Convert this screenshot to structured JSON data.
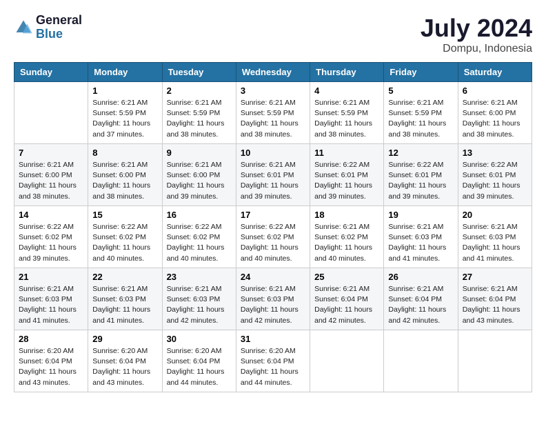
{
  "logo": {
    "line1": "General",
    "line2": "Blue"
  },
  "title": "July 2024",
  "location": "Dompu, Indonesia",
  "header": {
    "days": [
      "Sunday",
      "Monday",
      "Tuesday",
      "Wednesday",
      "Thursday",
      "Friday",
      "Saturday"
    ]
  },
  "weeks": [
    {
      "row": 1,
      "cells": [
        {
          "day": "",
          "info": ""
        },
        {
          "day": "1",
          "info": "Sunrise: 6:21 AM\nSunset: 5:59 PM\nDaylight: 11 hours\nand 37 minutes."
        },
        {
          "day": "2",
          "info": "Sunrise: 6:21 AM\nSunset: 5:59 PM\nDaylight: 11 hours\nand 38 minutes."
        },
        {
          "day": "3",
          "info": "Sunrise: 6:21 AM\nSunset: 5:59 PM\nDaylight: 11 hours\nand 38 minutes."
        },
        {
          "day": "4",
          "info": "Sunrise: 6:21 AM\nSunset: 5:59 PM\nDaylight: 11 hours\nand 38 minutes."
        },
        {
          "day": "5",
          "info": "Sunrise: 6:21 AM\nSunset: 5:59 PM\nDaylight: 11 hours\nand 38 minutes."
        },
        {
          "day": "6",
          "info": "Sunrise: 6:21 AM\nSunset: 6:00 PM\nDaylight: 11 hours\nand 38 minutes."
        }
      ]
    },
    {
      "row": 2,
      "cells": [
        {
          "day": "7",
          "info": "Sunrise: 6:21 AM\nSunset: 6:00 PM\nDaylight: 11 hours\nand 38 minutes."
        },
        {
          "day": "8",
          "info": "Sunrise: 6:21 AM\nSunset: 6:00 PM\nDaylight: 11 hours\nand 38 minutes."
        },
        {
          "day": "9",
          "info": "Sunrise: 6:21 AM\nSunset: 6:00 PM\nDaylight: 11 hours\nand 39 minutes."
        },
        {
          "day": "10",
          "info": "Sunrise: 6:21 AM\nSunset: 6:01 PM\nDaylight: 11 hours\nand 39 minutes."
        },
        {
          "day": "11",
          "info": "Sunrise: 6:22 AM\nSunset: 6:01 PM\nDaylight: 11 hours\nand 39 minutes."
        },
        {
          "day": "12",
          "info": "Sunrise: 6:22 AM\nSunset: 6:01 PM\nDaylight: 11 hours\nand 39 minutes."
        },
        {
          "day": "13",
          "info": "Sunrise: 6:22 AM\nSunset: 6:01 PM\nDaylight: 11 hours\nand 39 minutes."
        }
      ]
    },
    {
      "row": 3,
      "cells": [
        {
          "day": "14",
          "info": "Sunrise: 6:22 AM\nSunset: 6:02 PM\nDaylight: 11 hours\nand 39 minutes."
        },
        {
          "day": "15",
          "info": "Sunrise: 6:22 AM\nSunset: 6:02 PM\nDaylight: 11 hours\nand 40 minutes."
        },
        {
          "day": "16",
          "info": "Sunrise: 6:22 AM\nSunset: 6:02 PM\nDaylight: 11 hours\nand 40 minutes."
        },
        {
          "day": "17",
          "info": "Sunrise: 6:22 AM\nSunset: 6:02 PM\nDaylight: 11 hours\nand 40 minutes."
        },
        {
          "day": "18",
          "info": "Sunrise: 6:21 AM\nSunset: 6:02 PM\nDaylight: 11 hours\nand 40 minutes."
        },
        {
          "day": "19",
          "info": "Sunrise: 6:21 AM\nSunset: 6:03 PM\nDaylight: 11 hours\nand 41 minutes."
        },
        {
          "day": "20",
          "info": "Sunrise: 6:21 AM\nSunset: 6:03 PM\nDaylight: 11 hours\nand 41 minutes."
        }
      ]
    },
    {
      "row": 4,
      "cells": [
        {
          "day": "21",
          "info": "Sunrise: 6:21 AM\nSunset: 6:03 PM\nDaylight: 11 hours\nand 41 minutes."
        },
        {
          "day": "22",
          "info": "Sunrise: 6:21 AM\nSunset: 6:03 PM\nDaylight: 11 hours\nand 41 minutes."
        },
        {
          "day": "23",
          "info": "Sunrise: 6:21 AM\nSunset: 6:03 PM\nDaylight: 11 hours\nand 42 minutes."
        },
        {
          "day": "24",
          "info": "Sunrise: 6:21 AM\nSunset: 6:03 PM\nDaylight: 11 hours\nand 42 minutes."
        },
        {
          "day": "25",
          "info": "Sunrise: 6:21 AM\nSunset: 6:04 PM\nDaylight: 11 hours\nand 42 minutes."
        },
        {
          "day": "26",
          "info": "Sunrise: 6:21 AM\nSunset: 6:04 PM\nDaylight: 11 hours\nand 42 minutes."
        },
        {
          "day": "27",
          "info": "Sunrise: 6:21 AM\nSunset: 6:04 PM\nDaylight: 11 hours\nand 43 minutes."
        }
      ]
    },
    {
      "row": 5,
      "cells": [
        {
          "day": "28",
          "info": "Sunrise: 6:20 AM\nSunset: 6:04 PM\nDaylight: 11 hours\nand 43 minutes."
        },
        {
          "day": "29",
          "info": "Sunrise: 6:20 AM\nSunset: 6:04 PM\nDaylight: 11 hours\nand 43 minutes."
        },
        {
          "day": "30",
          "info": "Sunrise: 6:20 AM\nSunset: 6:04 PM\nDaylight: 11 hours\nand 44 minutes."
        },
        {
          "day": "31",
          "info": "Sunrise: 6:20 AM\nSunset: 6:04 PM\nDaylight: 11 hours\nand 44 minutes."
        },
        {
          "day": "",
          "info": ""
        },
        {
          "day": "",
          "info": ""
        },
        {
          "day": "",
          "info": ""
        }
      ]
    }
  ]
}
